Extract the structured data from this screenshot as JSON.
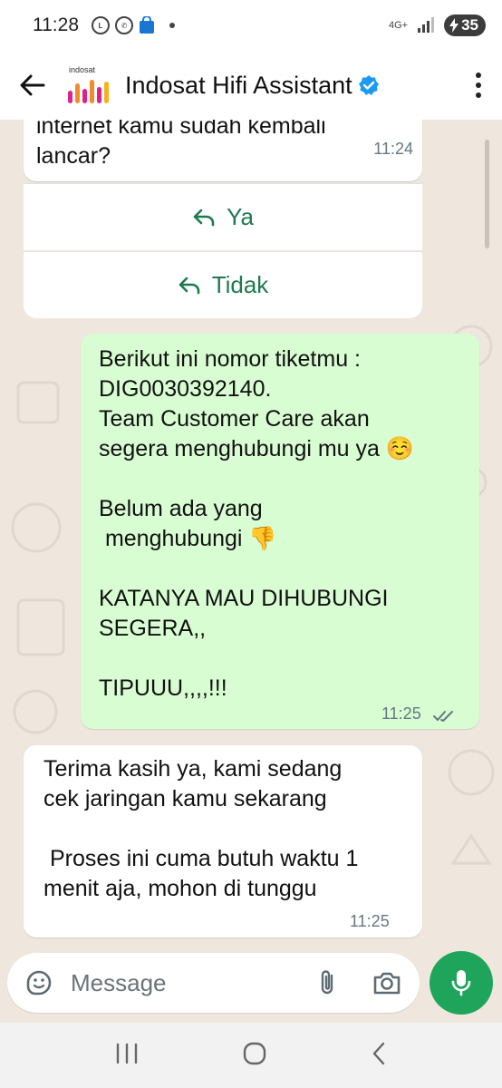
{
  "status_bar": {
    "time": "11:28",
    "network": "4G+",
    "battery": "35"
  },
  "header": {
    "logo_brand": "indosat",
    "title": "Indosat Hifi Assistant"
  },
  "messages": [
    {
      "direction": "in",
      "text": "internet kamu sudah kembali\nlancar?",
      "time": "11:24",
      "quick_replies": [
        "Ya",
        "Tidak"
      ]
    },
    {
      "direction": "out",
      "text": "Berikut ini nomor tiketmu :\nDIG0030392140.\nTeam Customer Care akan\nsegera menghubungi mu ya ☺️\n\nBelum ada yang\n menghubungi 👎\n\nKATANYA MAU DIHUBUNGI\nSEGERA,,\n\nTIPUUU,,,,!!!",
      "time": "11:25"
    },
    {
      "direction": "in",
      "text": "Terima kasih ya, kami sedang\ncek jaringan kamu sekarang\n\n Proses ini cuma butuh waktu 1\nmenit aja, mohon di tunggu",
      "time": "11:25"
    }
  ],
  "composer": {
    "placeholder": "Message"
  },
  "colors": {
    "chat_background": "#efe7dd",
    "outgoing_bubble": "#d9fdd3",
    "accent_green": "#1fa55b",
    "verified_blue": "#1d9bf0"
  },
  "icons": {
    "back": "arrow-left-icon",
    "verified": "verified-badge-icon",
    "menu": "more-vertical-icon",
    "reply": "reply-icon",
    "read": "double-check-icon",
    "emoji": "sticker-icon",
    "attach": "paperclip-icon",
    "camera": "camera-icon",
    "mic": "microphone-icon"
  }
}
